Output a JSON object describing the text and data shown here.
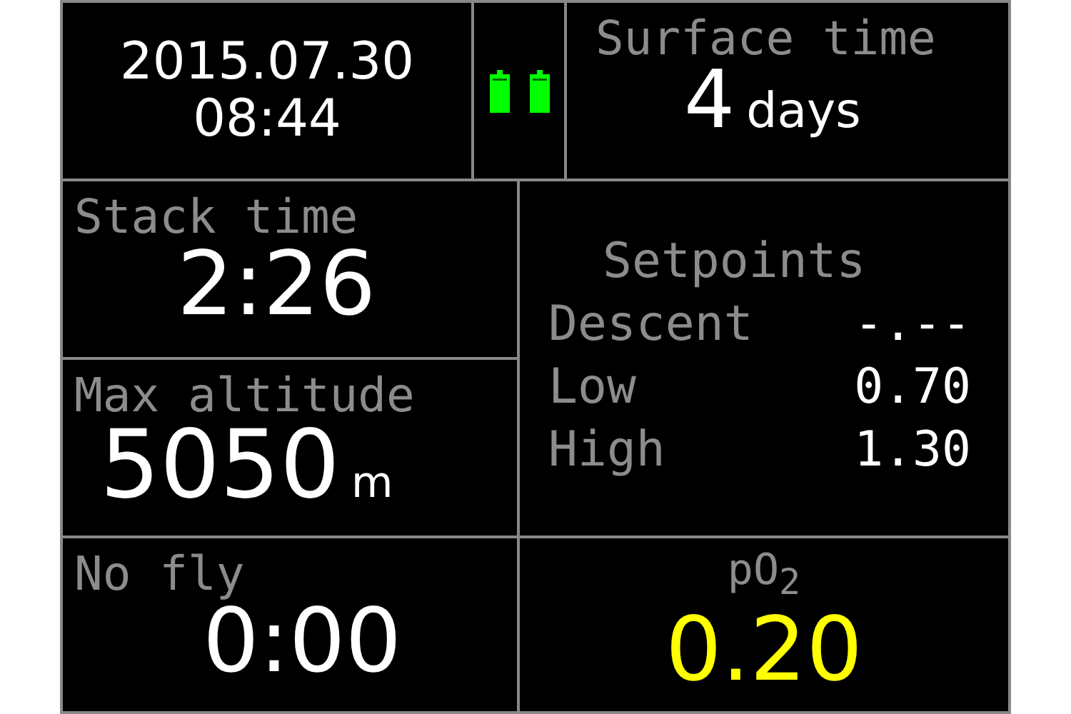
{
  "clock": {
    "date": "2015.07.30",
    "time": "08:44"
  },
  "surface_time": {
    "label": "Surface time",
    "value": "4",
    "unit": "days"
  },
  "stack_time": {
    "label": "Stack time",
    "value": "2:26"
  },
  "max_altitude": {
    "label": "Max altitude",
    "value": "5050",
    "unit": "m"
  },
  "setpoints": {
    "title": "Setpoints",
    "rows": [
      {
        "label": "Descent",
        "value": "-.--"
      },
      {
        "label": "Low",
        "value": "0.70"
      },
      {
        "label": "High",
        "value": "1.30"
      }
    ]
  },
  "no_fly": {
    "label": "No fly",
    "value": "0:00"
  },
  "po2": {
    "label": "pO$_{2}$",
    "value": "0.20",
    "color": "#ffff00"
  }
}
